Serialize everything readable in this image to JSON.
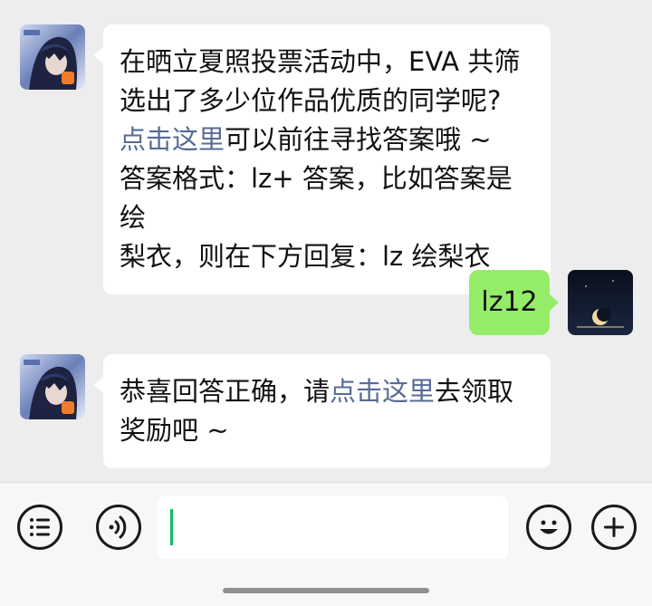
{
  "messages": [
    {
      "sender": "bot",
      "line1": "在晒立夏照投票活动中，EVA 共筛",
      "line2": "选出了多少位作品优质的同学呢?",
      "link": "点击这里",
      "line3_rest": "可以前往寻找答案哦 ~",
      "line4": "答案格式：lz+ 答案，比如答案是绘",
      "line5": "梨衣，则在下方回复：lz 绘梨衣"
    },
    {
      "sender": "user",
      "text": "lz12"
    },
    {
      "sender": "bot",
      "prefix": "恭喜回答正确，请",
      "link": "点击这里",
      "suffix": "去领取",
      "line2": "奖励吧 ~"
    }
  ],
  "input_bar": {
    "value": "",
    "icons": [
      "list-icon",
      "voice-icon",
      "emoji-icon",
      "plus-icon"
    ]
  },
  "colors": {
    "background": "#ededed",
    "bubble_other": "#ffffff",
    "bubble_self": "#95ec69",
    "link": "#576b95",
    "caret": "#07c160"
  }
}
